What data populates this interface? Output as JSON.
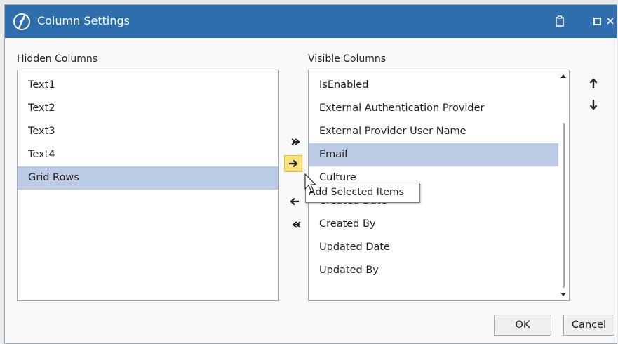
{
  "window": {
    "title": "Column Settings"
  },
  "titlebar": {
    "icons": [
      "app-logo-icon",
      "clipboard-icon",
      "maximize-icon",
      "close-icon"
    ]
  },
  "hidden": {
    "label": "Hidden Columns",
    "items": [
      {
        "label": "Text1"
      },
      {
        "label": "Text2"
      },
      {
        "label": "Text3"
      },
      {
        "label": "Text4"
      },
      {
        "label": "Grid Rows",
        "selected": true
      }
    ]
  },
  "visible": {
    "label": "Visible Columns",
    "items": [
      {
        "label": "IsEnabled"
      },
      {
        "label": "External Authentication Provider"
      },
      {
        "label": "External Provider User Name"
      },
      {
        "label": "Email",
        "selected": true
      },
      {
        "label": "Culture"
      },
      {
        "label": "Created Date"
      },
      {
        "label": "Created By"
      },
      {
        "label": "Updated Date"
      },
      {
        "label": "Updated By"
      }
    ]
  },
  "move_buttons": [
    "add-all-icon",
    "add-selected-icon",
    "remove-selected-icon",
    "remove-all-icon"
  ],
  "reorder_buttons": [
    "move-up-icon",
    "move-down-icon"
  ],
  "tooltip": {
    "text": "Add Selected Items"
  },
  "buttons": {
    "ok": "OK",
    "cancel": "Cancel"
  },
  "colors": {
    "titlebar": "#2e6ead",
    "selection": "#bccbe6",
    "hover_button": "#fbe27a"
  }
}
